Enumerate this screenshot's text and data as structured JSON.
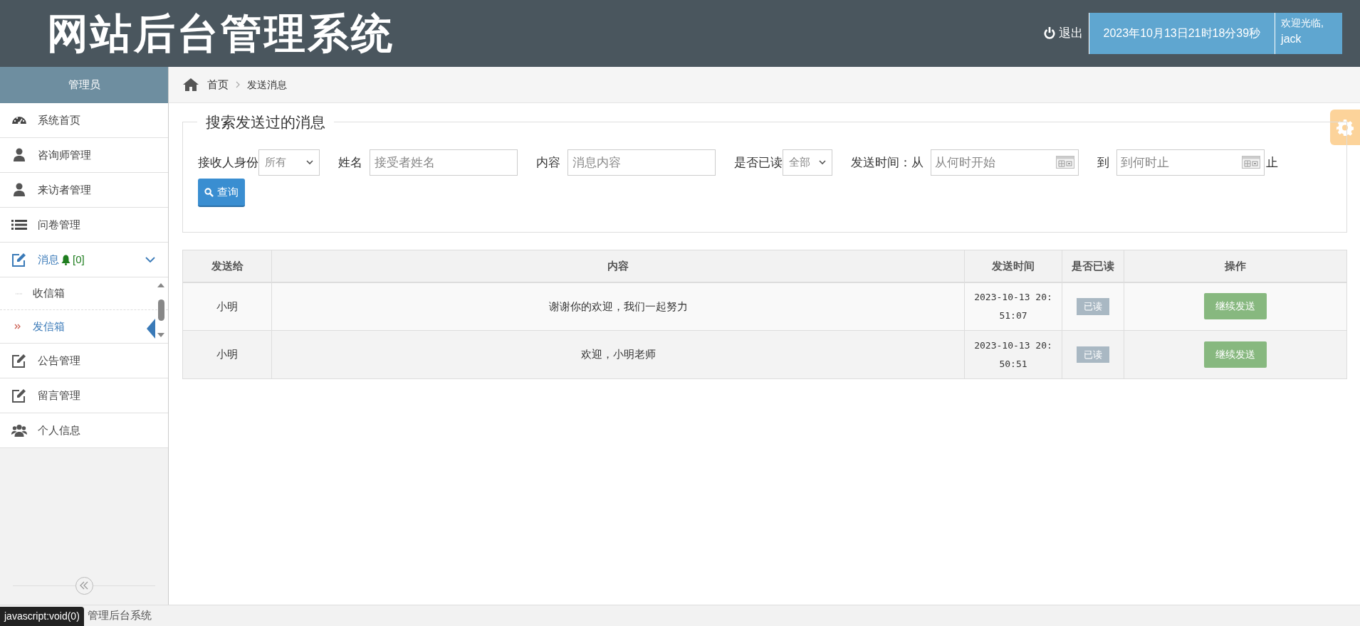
{
  "header": {
    "title": "网站后台管理系统",
    "logout": "退出",
    "datetime": "2023年10月13日21时18分39秒",
    "welcome": "欢迎光临,",
    "user": "jack"
  },
  "sidebar": {
    "role": "管理员",
    "items": [
      {
        "label": "系统首页",
        "selected": false
      },
      {
        "label": "咨询师管理",
        "selected": false
      },
      {
        "label": "来访者管理",
        "selected": false
      },
      {
        "label": "问卷管理",
        "selected": false
      },
      {
        "label": "消息",
        "badge": "[0]",
        "selected": false,
        "expanded": true,
        "children": [
          {
            "label": "收信箱",
            "selected": false
          },
          {
            "label": "发信箱",
            "selected": true
          }
        ]
      },
      {
        "label": "公告管理",
        "selected": false
      },
      {
        "label": "留言管理",
        "selected": false
      },
      {
        "label": "个人信息",
        "selected": false
      }
    ]
  },
  "breadcrumb": [
    "首页",
    "发送消息"
  ],
  "search": {
    "legend": "搜索发送过的消息",
    "filters": [
      {
        "kind": "select",
        "label": "接收人身份",
        "value": "所有"
      },
      {
        "kind": "text",
        "label": "姓名",
        "placeholder": "接受者姓名"
      },
      {
        "kind": "text",
        "label": "内容",
        "placeholder": "消息内容"
      },
      {
        "kind": "select",
        "label": "是否已读",
        "value": "全部"
      },
      {
        "kind": "date",
        "label": "发送时间：从",
        "placeholder": "从何时开始"
      },
      {
        "kind": "date",
        "label": "到",
        "placeholder": "到何时止",
        "suffix": "止"
      }
    ],
    "button": "查询"
  },
  "table": {
    "columns": [
      "发送给",
      "内容",
      "发送时间",
      "是否已读",
      "操作"
    ],
    "rows": [
      {
        "to": "小明",
        "content": "谢谢你的欢迎，我们一起努力",
        "time": "2023-10-13 20:51:07",
        "status": "已读",
        "read": true,
        "action": "继续发送"
      },
      {
        "to": "小明",
        "content": "欢迎，小明老师",
        "time": "2023-10-13 20:50:51",
        "status": "已读",
        "read": true,
        "action": "继续发送"
      }
    ]
  },
  "footer": {
    "text": "管理后台系统"
  },
  "status_tooltip": "javascript:void(0)"
}
